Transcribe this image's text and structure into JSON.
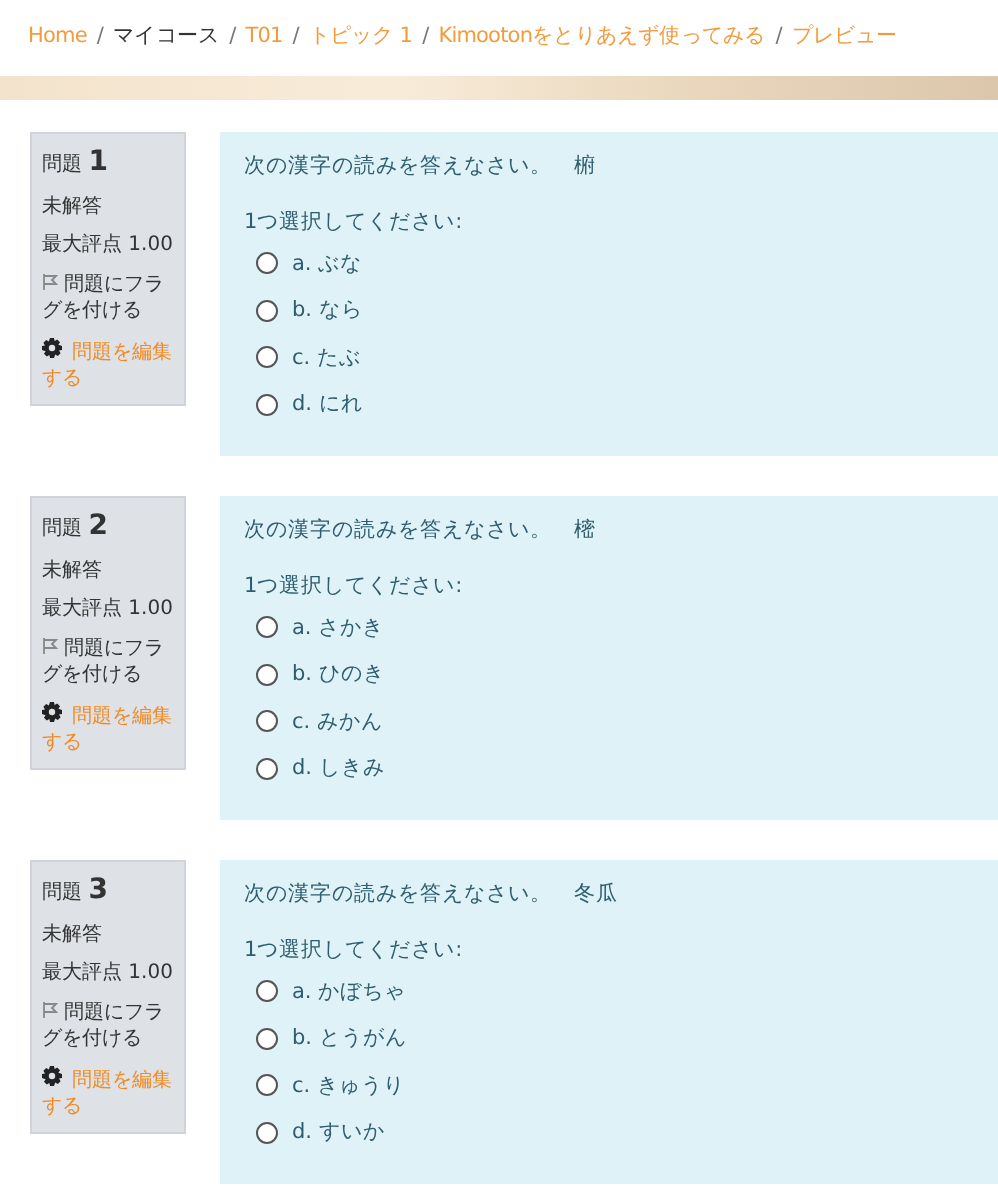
{
  "breadcrumb_separator": "/",
  "breadcrumb": [
    {
      "label": "Home",
      "link": true
    },
    {
      "label": "マイコース",
      "link": false
    },
    {
      "label": "T01",
      "link": true
    },
    {
      "label": "トピック 1",
      "link": true
    },
    {
      "label": "Kimootonをとりあえず使ってみる",
      "link": true
    },
    {
      "label": "プレビュー",
      "link": true
    }
  ],
  "questions": [
    {
      "label": "問題",
      "number": "1",
      "status": "未解答",
      "max_grade": "最大評点 1.00",
      "flag": "問題にフラグを付ける",
      "edit": "問題を編集する",
      "text": "次の漢字の読みを答えなさい。　椨",
      "prompt": "1つ選択してください:",
      "options": [
        {
          "label": "a. ぶな",
          "selected": false
        },
        {
          "label": "b. なら",
          "selected": false
        },
        {
          "label": "c. たぶ",
          "selected": false
        },
        {
          "label": "d. にれ",
          "selected": false
        }
      ]
    },
    {
      "label": "問題",
      "number": "2",
      "status": "未解答",
      "max_grade": "最大評点 1.00",
      "flag": "問題にフラグを付ける",
      "edit": "問題を編集する",
      "text": "次の漢字の読みを答えなさい。　樒",
      "prompt": "1つ選択してください:",
      "options": [
        {
          "label": "a. さかき",
          "selected": false
        },
        {
          "label": "b. ひのき",
          "selected": false
        },
        {
          "label": "c. みかん",
          "selected": false
        },
        {
          "label": "d. しきみ",
          "selected": false
        }
      ]
    },
    {
      "label": "問題",
      "number": "3",
      "status": "未解答",
      "max_grade": "最大評点 1.00",
      "flag": "問題にフラグを付ける",
      "edit": "問題を編集する",
      "text": "次の漢字の読みを答えなさい。　冬瓜",
      "prompt": "1つ選択してください:",
      "options": [
        {
          "label": "a. かぼちゃ",
          "selected": false
        },
        {
          "label": "b. とうがん",
          "selected": false
        },
        {
          "label": "c. きゅうり",
          "selected": false
        },
        {
          "label": "d. すいか",
          "selected": false
        }
      ]
    }
  ]
}
